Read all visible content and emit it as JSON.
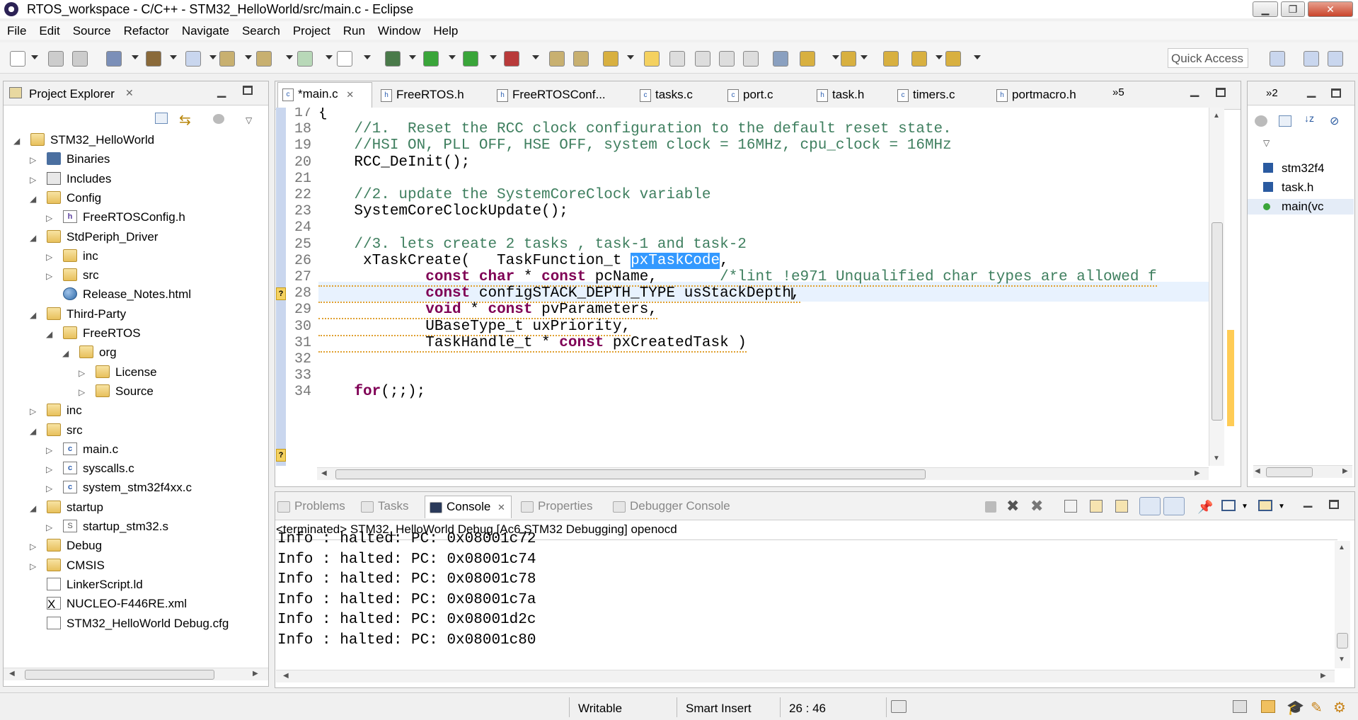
{
  "window": {
    "title": "RTOS_workspace - C/C++ - STM32_HelloWorld/src/main.c - Eclipse",
    "minimize": "▁",
    "restore": "❐",
    "close": "✕"
  },
  "menu": [
    "File",
    "Edit",
    "Source",
    "Refactor",
    "Navigate",
    "Search",
    "Project",
    "Run",
    "Window",
    "Help"
  ],
  "toolbar": {
    "quick_access_placeholder": "Quick Access"
  },
  "project_explorer": {
    "title": "Project Explorer",
    "tree": [
      {
        "label": "STM32_HelloWorld",
        "icon": "project-icon",
        "depth": 0,
        "arrow": "◢"
      },
      {
        "label": "Binaries",
        "icon": "binaries-icon",
        "depth": 1,
        "arrow": "▷"
      },
      {
        "label": "Includes",
        "icon": "includes-icon",
        "depth": 1,
        "arrow": "▷"
      },
      {
        "label": "Config",
        "icon": "folder-icon",
        "depth": 1,
        "arrow": "◢"
      },
      {
        "label": "FreeRTOSConfig.h",
        "icon": "header-file-icon",
        "depth": 2,
        "arrow": "▷"
      },
      {
        "label": "StdPeriph_Driver",
        "icon": "folder-icon",
        "depth": 1,
        "arrow": "◢"
      },
      {
        "label": "inc",
        "icon": "folder-icon",
        "depth": 2,
        "arrow": "▷"
      },
      {
        "label": "src",
        "icon": "folder-icon",
        "depth": 2,
        "arrow": "▷"
      },
      {
        "label": "Release_Notes.html",
        "icon": "html-file-icon",
        "depth": 2,
        "arrow": ""
      },
      {
        "label": "Third-Party",
        "icon": "folder-icon",
        "depth": 1,
        "arrow": "◢"
      },
      {
        "label": "FreeRTOS",
        "icon": "folder-icon",
        "depth": 2,
        "arrow": "◢"
      },
      {
        "label": "org",
        "icon": "folder-icon",
        "depth": 3,
        "arrow": "◢"
      },
      {
        "label": "License",
        "icon": "folder-icon",
        "depth": 4,
        "arrow": "▷"
      },
      {
        "label": "Source",
        "icon": "folder-icon",
        "depth": 4,
        "arrow": "▷"
      },
      {
        "label": "inc",
        "icon": "folder-icon",
        "depth": 1,
        "arrow": "▷"
      },
      {
        "label": "src",
        "icon": "folder-icon",
        "depth": 1,
        "arrow": "◢"
      },
      {
        "label": "main.c",
        "icon": "c-file-icon",
        "depth": 2,
        "arrow": "▷"
      },
      {
        "label": "syscalls.c",
        "icon": "c-file-icon",
        "depth": 2,
        "arrow": "▷"
      },
      {
        "label": "system_stm32f4xx.c",
        "icon": "c-file-icon",
        "depth": 2,
        "arrow": "▷"
      },
      {
        "label": "startup",
        "icon": "folder-icon",
        "depth": 1,
        "arrow": "◢"
      },
      {
        "label": "startup_stm32.s",
        "icon": "asm-file-icon",
        "depth": 2,
        "arrow": "▷"
      },
      {
        "label": "Debug",
        "icon": "folder-icon",
        "depth": 1,
        "arrow": "▷"
      },
      {
        "label": "CMSIS",
        "icon": "folder-icon",
        "depth": 1,
        "arrow": "▷"
      },
      {
        "label": "LinkerScript.ld",
        "icon": "generic-file-icon",
        "depth": 1,
        "arrow": ""
      },
      {
        "label": "NUCLEO-F446RE.xml",
        "icon": "xml-file-icon",
        "depth": 1,
        "arrow": ""
      },
      {
        "label": "STM32_HelloWorld Debug.cfg",
        "icon": "generic-file-icon",
        "depth": 1,
        "arrow": ""
      }
    ]
  },
  "editor_tabs": [
    {
      "label": "*main.c",
      "active": true
    },
    {
      "label": "FreeRTOS.h"
    },
    {
      "label": "FreeRTOSConf..."
    },
    {
      "label": "tasks.c"
    },
    {
      "label": "port.c"
    },
    {
      "label": "task.h"
    },
    {
      "label": "timers.c"
    },
    {
      "label": "portmacro.h"
    }
  ],
  "editor_overflow": "»5",
  "code_lines": [
    {
      "n": "17",
      "parts": [
        {
          "t": "{"
        }
      ]
    },
    {
      "n": "18",
      "parts": [
        {
          "t": "    //1.  Reset the RCC clock configuration to the default reset state.",
          "c": "cmt"
        }
      ]
    },
    {
      "n": "19",
      "parts": [
        {
          "t": "    //HSI ON, PLL OFF, HSE OFF, system clock = 16MHz, cpu_clock = 16MHz",
          "c": "cmt"
        }
      ]
    },
    {
      "n": "20",
      "parts": [
        {
          "t": "    RCC_DeInit();"
        }
      ]
    },
    {
      "n": "21",
      "parts": [
        {
          "t": ""
        }
      ]
    },
    {
      "n": "22",
      "parts": [
        {
          "t": "    //2. update the SystemCoreClock variable",
          "c": "cmt"
        }
      ]
    },
    {
      "n": "23",
      "parts": [
        {
          "t": "    SystemCoreClockUpdate();"
        }
      ]
    },
    {
      "n": "24",
      "parts": [
        {
          "t": ""
        }
      ]
    },
    {
      "n": "25",
      "parts": [
        {
          "t": "    //3. lets create 2 tasks , task-1 and task-2",
          "c": "cmt"
        }
      ]
    },
    {
      "n": "26",
      "parts": [
        {
          "t": "     xTaskCreate(   TaskFunction_t "
        },
        {
          "t": "pxTaskCode",
          "c": "hl"
        },
        {
          "t": ","
        }
      ]
    },
    {
      "n": "27",
      "parts": [
        {
          "t": "            "
        },
        {
          "t": "const",
          "c": "kw"
        },
        {
          "t": " "
        },
        {
          "t": "char",
          "c": "kw"
        },
        {
          "t": " * "
        },
        {
          "t": "const",
          "c": "kw"
        },
        {
          "t": " pcName,       "
        },
        {
          "t": "/*lint !e971 Unqualified char types are allowed f",
          "c": "cmt"
        }
      ]
    },
    {
      "n": "28",
      "parts": [
        {
          "t": "            "
        },
        {
          "t": "const",
          "c": "kw"
        },
        {
          "t": " configSTACK_DEPTH_TYPE usStackDepth,"
        }
      ]
    },
    {
      "n": "29",
      "parts": [
        {
          "t": "            "
        },
        {
          "t": "void",
          "c": "kw"
        },
        {
          "t": " * "
        },
        {
          "t": "const",
          "c": "kw"
        },
        {
          "t": " pvParameters,"
        }
      ]
    },
    {
      "n": "30",
      "parts": [
        {
          "t": "            UBaseType_t uxPriority,"
        }
      ]
    },
    {
      "n": "31",
      "parts": [
        {
          "t": "            TaskHandle_t * "
        },
        {
          "t": "const",
          "c": "kw"
        },
        {
          "t": " pxCreatedTask )"
        }
      ]
    },
    {
      "n": "32",
      "parts": [
        {
          "t": ""
        }
      ]
    },
    {
      "n": "33",
      "parts": [
        {
          "t": ""
        }
      ]
    },
    {
      "n": "34",
      "parts": [
        {
          "t": "    "
        },
        {
          "t": "for",
          "c": "kw"
        },
        {
          "t": "(;;);"
        }
      ]
    }
  ],
  "outline": {
    "tab": "»2",
    "items": [
      {
        "label": "stm32f4",
        "icon": "include-icon"
      },
      {
        "label": "task.h",
        "icon": "include-icon"
      },
      {
        "label": "main(vc",
        "icon": "function-icon"
      }
    ]
  },
  "bottom_tabs": [
    {
      "label": "Problems"
    },
    {
      "label": "Tasks"
    },
    {
      "label": "Console",
      "active": true
    },
    {
      "label": "Properties"
    },
    {
      "label": "Debugger Console"
    }
  ],
  "console": {
    "header": "<terminated> STM32_HelloWorld Debug [Ac6 STM32 Debugging] openocd",
    "lines": [
      "Info : halted: PC: 0x08001c72",
      "Info : halted: PC: 0x08001c74",
      "Info : halted: PC: 0x08001c78",
      "Info : halted: PC: 0x08001c7a",
      "Info : halted: PC: 0x08001d2c",
      "Info : halted: PC: 0x08001c80"
    ]
  },
  "status": {
    "writable": "Writable",
    "insert_mode": "Smart Insert",
    "position": "26 : 46"
  }
}
